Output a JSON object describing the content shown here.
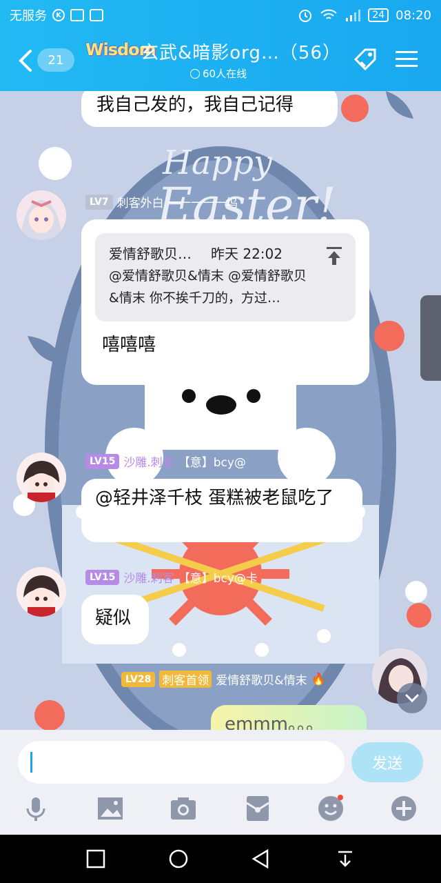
{
  "status_bar": {
    "carrier": "无服务",
    "badge_k": "K",
    "battery": "24",
    "time": "08:20"
  },
  "header": {
    "unread_count": "21",
    "logo_text": "Wisdom",
    "group_title": "玄武&暗影org…（56）",
    "online_text": "60人在线"
  },
  "messages": [
    {
      "id": "m0",
      "text": "我自己发的，我自己记得"
    },
    {
      "id": "m1",
      "level": "LV7",
      "sender": "刺客外白 一一一一一坞",
      "quote": {
        "author": "爱情舒歌贝…",
        "time": "昨天 22:02",
        "body": "@爱情舒歌贝&情末 @爱情舒歌贝&情末 你不挨千刀的，方过…"
      },
      "text": "嘻嘻嘻"
    },
    {
      "id": "m2",
      "level": "LV15",
      "sender": "沙雕.刺客",
      "sender_extra": "【意】bcy@",
      "text": "@轻井泽千枝 蛋糕被老鼠吃了"
    },
    {
      "id": "m3",
      "level": "LV15",
      "sender": "沙雕.刺客",
      "sender_extra": "【意】bcy@卡",
      "text": "疑似"
    },
    {
      "id": "m4",
      "level": "LV28",
      "sender_title": "刺客首领",
      "sender": "爱情舒歌贝&情末",
      "text": "emmm。。。"
    }
  ],
  "input": {
    "placeholder": "",
    "send_label": "发送"
  },
  "icons": {
    "tools": [
      "microphone-icon",
      "image-icon",
      "camera-icon",
      "red-packet-icon",
      "emoji-icon",
      "plus-icon"
    ],
    "nav": [
      "recent-apps-icon",
      "home-icon",
      "back-icon",
      "notification-pull-icon"
    ]
  },
  "colors": {
    "header_bg": "#19a8f0",
    "bubble_bg": "#ffffff",
    "send_button": "#aee3f7"
  }
}
